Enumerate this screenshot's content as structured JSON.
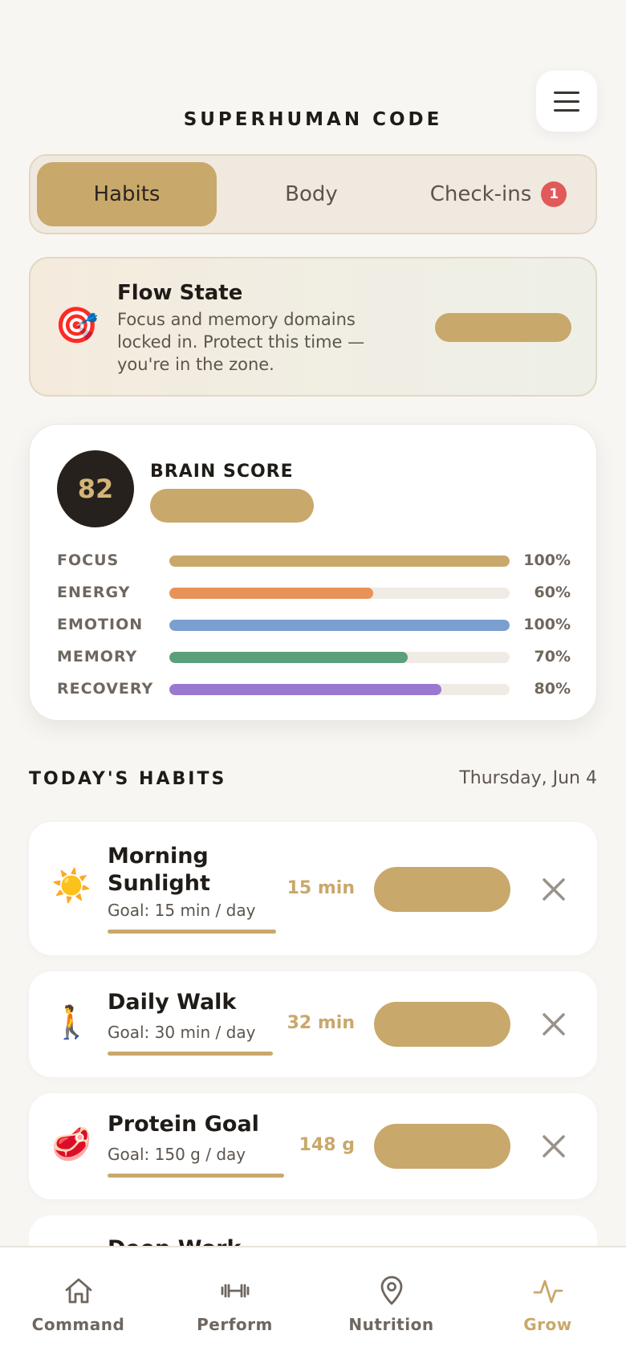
{
  "header": {
    "title": "SUPERHUMAN CODE",
    "menu_icon": "hamburger-icon"
  },
  "tabs": [
    {
      "label": "Habits",
      "active": true
    },
    {
      "label": "Body",
      "active": false
    },
    {
      "label": "Check-ins",
      "active": false,
      "badge": "1"
    }
  ],
  "flow_state": {
    "icon": "target-icon",
    "title": "Flow State",
    "text": "Focus and memory domains locked in. Protect this time — you're in the zone."
  },
  "brain_score": {
    "score": "82",
    "label": "BRAIN SCORE",
    "metrics": [
      {
        "name": "FOCUS",
        "pct_label": "100%",
        "value": 1.0,
        "color": "#c9a86b"
      },
      {
        "name": "ENERGY",
        "pct_label": "60%",
        "value": 0.6,
        "color": "#e8925a"
      },
      {
        "name": "EMOTION",
        "pct_label": "100%",
        "value": 1.0,
        "color": "#7a9fd0"
      },
      {
        "name": "MEMORY",
        "pct_label": "70%",
        "value": 0.7,
        "color": "#5aa07a"
      },
      {
        "name": "RECOVERY",
        "pct_label": "80%",
        "value": 0.8,
        "color": "#9a78d0"
      }
    ]
  },
  "habits_section": {
    "title": "TODAY'S HABITS",
    "date": "Thursday, Jun 4"
  },
  "habits": [
    {
      "icon": "sun-icon",
      "name_line1": "Morning",
      "name_line2": "Sunlight",
      "goal": "Goal: 15 min / day",
      "value": "15 min",
      "progress": 1.0
    },
    {
      "icon": "walking-person-icon",
      "name": "Daily Walk",
      "goal": "Goal: 30 min / day",
      "value": "32 min",
      "progress": 1.0
    },
    {
      "icon": "steak-icon",
      "name": "Protein Goal",
      "goal": "Goal: 150 g / day",
      "value": "148 g",
      "progress": 0.99
    }
  ],
  "partial_habit": {
    "name": "Deep Work"
  },
  "colors": {
    "accent": "#c9a86b",
    "badge": "#e05a5a",
    "background": "#f8f6f3"
  },
  "nav": [
    {
      "label": "Command",
      "icon": "home-icon",
      "active": false
    },
    {
      "label": "Perform",
      "icon": "dumbbell-icon",
      "active": false
    },
    {
      "label": "Nutrition",
      "icon": "location-pin-icon",
      "active": false
    },
    {
      "label": "Grow",
      "icon": "activity-icon",
      "active": true
    }
  ]
}
